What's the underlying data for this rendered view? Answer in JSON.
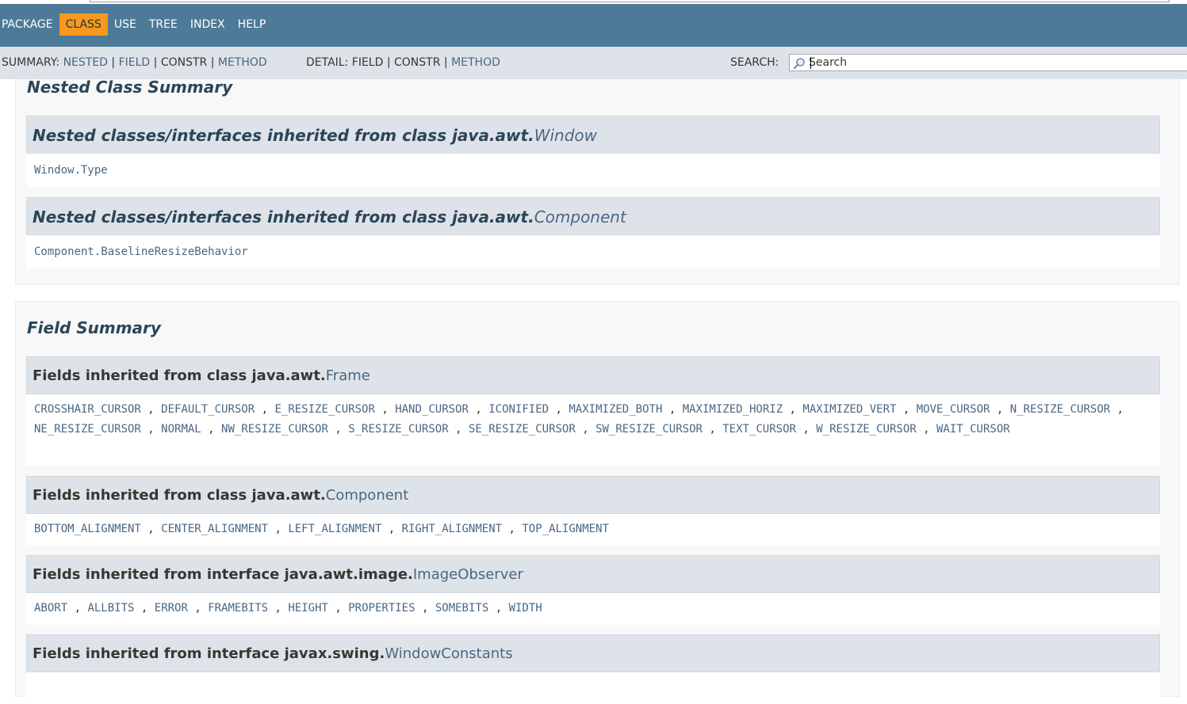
{
  "navbar": {
    "items": [
      "PACKAGE",
      "CLASS",
      "USE",
      "TREE",
      "INDEX",
      "HELP"
    ],
    "active_index": 1
  },
  "subnav": {
    "summary_label": "SUMMARY:",
    "summary_nested": "NESTED",
    "summary_field": "FIELD",
    "summary_constr": "CONSTR",
    "summary_method": "METHOD",
    "detail_label": "DETAIL:",
    "detail_field": "FIELD",
    "detail_constr": "CONSTR",
    "detail_method": "METHOD",
    "sep": "|",
    "search_label": "SEARCH:",
    "search_value": "Search"
  },
  "nested": {
    "title": "Nested Class Summary",
    "groups": [
      {
        "prefix": "Nested classes/interfaces inherited from class java.awt.",
        "link": "Window",
        "items": [
          "Window.Type"
        ]
      },
      {
        "prefix": "Nested classes/interfaces inherited from class java.awt.",
        "link": "Component",
        "items": [
          "Component.BaselineResizeBehavior"
        ]
      }
    ]
  },
  "fields": {
    "title": "Field Summary",
    "groups": [
      {
        "prefix": "Fields inherited from class java.awt.",
        "link": "Frame",
        "items": [
          "CROSSHAIR_CURSOR",
          "DEFAULT_CURSOR",
          "E_RESIZE_CURSOR",
          "HAND_CURSOR",
          "ICONIFIED",
          "MAXIMIZED_BOTH",
          "MAXIMIZED_HORIZ",
          "MAXIMIZED_VERT",
          "MOVE_CURSOR",
          "N_RESIZE_CURSOR",
          "NE_RESIZE_CURSOR",
          "NORMAL",
          "NW_RESIZE_CURSOR",
          "S_RESIZE_CURSOR",
          "SE_RESIZE_CURSOR",
          "SW_RESIZE_CURSOR",
          "TEXT_CURSOR",
          "W_RESIZE_CURSOR",
          "WAIT_CURSOR"
        ]
      },
      {
        "prefix": "Fields inherited from class java.awt.",
        "link": "Component",
        "items": [
          "BOTTOM_ALIGNMENT",
          "CENTER_ALIGNMENT",
          "LEFT_ALIGNMENT",
          "RIGHT_ALIGNMENT",
          "TOP_ALIGNMENT"
        ]
      },
      {
        "prefix": "Fields inherited from interface java.awt.image.",
        "link": "ImageObserver",
        "items": [
          "ABORT",
          "ALLBITS",
          "ERROR",
          "FRAMEBITS",
          "HEIGHT",
          "PROPERTIES",
          "SOMEBITS",
          "WIDTH"
        ]
      },
      {
        "prefix": "Fields inherited from interface javax.swing.",
        "link": "WindowConstants",
        "items": []
      }
    ]
  },
  "list_separator": ","
}
